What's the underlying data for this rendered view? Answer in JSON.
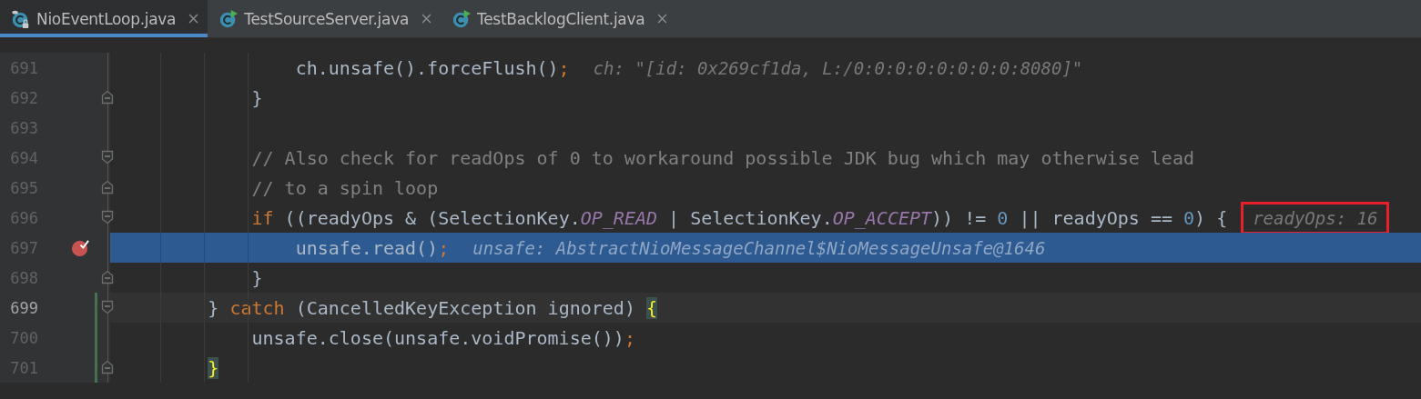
{
  "tabs": [
    {
      "label": "NioEventLoop.java",
      "kind": "locked",
      "selected": true
    },
    {
      "label": "TestSourceServer.java",
      "kind": "runnable",
      "selected": false
    },
    {
      "label": "TestBacklogClient.java",
      "kind": "runnable",
      "selected": false
    }
  ],
  "lines": [
    {
      "number": "691",
      "tokens": [
        {
          "kind": "plain",
          "text": "ch.unsafe().forceFlush()"
        },
        {
          "kind": "punct",
          "text": ";"
        }
      ],
      "hint": {
        "text": "ch: \"[id: 0x269cf1da, L:/0:0:0:0:0:0:0:0:8080]\"",
        "highlighted": false
      },
      "kind": "plain",
      "execution": false,
      "caret": false,
      "breakpoint": false,
      "changed": false
    },
    {
      "number": "692",
      "tokens": [
        {
          "kind": "plain",
          "text": "}"
        }
      ],
      "kind": "fold-end",
      "execution": false,
      "caret": false,
      "breakpoint": false,
      "changed": false
    },
    {
      "number": "693",
      "kind": "plain",
      "execution": false,
      "caret": false,
      "breakpoint": false,
      "changed": false
    },
    {
      "number": "694",
      "tokens": [
        {
          "kind": "comment",
          "text": "// Also check for readOps of 0 to workaround possible JDK bug which may otherwise lead"
        }
      ],
      "kind": "fold-start",
      "execution": false,
      "caret": false,
      "breakpoint": false,
      "changed": false
    },
    {
      "number": "695",
      "tokens": [
        {
          "kind": "comment",
          "text": "// to a spin loop"
        }
      ],
      "kind": "fold-end",
      "execution": false,
      "caret": false,
      "breakpoint": false,
      "changed": false
    },
    {
      "number": "696",
      "tokens": [
        {
          "kind": "keyword",
          "text": "if"
        },
        {
          "kind": "plain",
          "text": " ((readyOps & (SelectionKey."
        },
        {
          "kind": "constant",
          "text": "OP_READ"
        },
        {
          "kind": "plain",
          "text": " | SelectionKey."
        },
        {
          "kind": "constant",
          "text": "OP_ACCEPT"
        },
        {
          "kind": "plain",
          "text": ")) != "
        },
        {
          "kind": "number",
          "text": "0"
        },
        {
          "kind": "plain",
          "text": " || readyOps == "
        },
        {
          "kind": "number",
          "text": "0"
        },
        {
          "kind": "plain",
          "text": ") {"
        }
      ],
      "hint": {
        "text": "readyOps: 16",
        "highlighted": true
      },
      "kind": "fold-start",
      "execution": false,
      "caret": false,
      "breakpoint": false,
      "changed": false
    },
    {
      "number": "697",
      "tokens": [
        {
          "kind": "plain",
          "text": "unsafe.read()"
        },
        {
          "kind": "punct",
          "text": ";"
        }
      ],
      "hint": {
        "text": "unsafe: AbstractNioMessageChannel$NioMessageUnsafe@1646",
        "highlighted": false
      },
      "kind": "plain",
      "execution": true,
      "caret": false,
      "breakpoint": true,
      "changed": false
    },
    {
      "number": "698",
      "tokens": [
        {
          "kind": "plain",
          "text": "}"
        }
      ],
      "kind": "fold-end",
      "execution": false,
      "caret": false,
      "breakpoint": false,
      "changed": false
    },
    {
      "number": "699",
      "tokens": [
        {
          "kind": "plain",
          "text": "} "
        },
        {
          "kind": "keyword",
          "text": "catch"
        },
        {
          "kind": "plain",
          "text": " (CancelledKeyException ignored) "
        },
        {
          "kind": "brace",
          "text": "{"
        }
      ],
      "kind": "fold-start",
      "execution": false,
      "caret": true,
      "breakpoint": false,
      "changed": true
    },
    {
      "number": "700",
      "tokens": [
        {
          "kind": "plain",
          "text": "unsafe.close(unsafe.voidPromise())"
        },
        {
          "kind": "punct",
          "text": ";"
        }
      ],
      "kind": "plain",
      "execution": false,
      "caret": false,
      "breakpoint": false,
      "changed": true
    },
    {
      "number": "701",
      "tokens": [
        {
          "kind": "brace",
          "text": "}"
        }
      ],
      "kind": "fold-end",
      "execution": false,
      "caret": false,
      "breakpoint": false,
      "changed": true
    }
  ]
}
